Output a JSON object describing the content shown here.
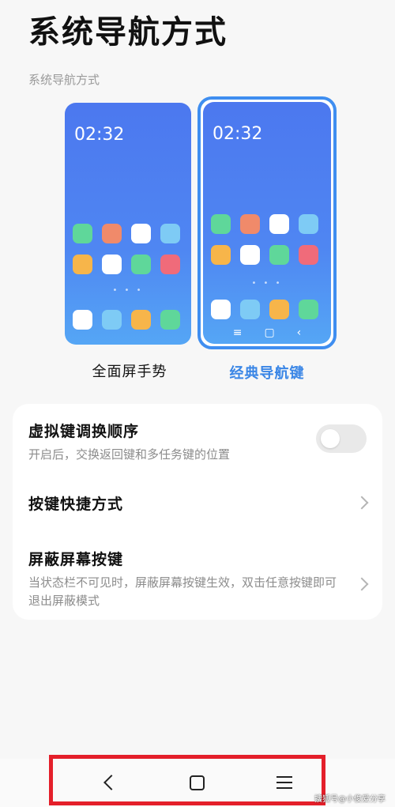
{
  "page": {
    "title": "系统导航方式",
    "section_label": "系统导航方式"
  },
  "options": {
    "gesture": {
      "time": "02:32",
      "label": "全面屏手势",
      "selected": false,
      "apps": [
        "#5fd79a",
        "#f08a6a",
        "#ffffff",
        "#7ecbf5",
        "#f7b54a",
        "#ffffff",
        "#5fd79a",
        "#f06b7a"
      ],
      "dock": [
        "#ffffff",
        "#7ecbf5",
        "#f7b54a",
        "#5fd79a"
      ]
    },
    "classic": {
      "time": "02:32",
      "label": "经典导航键",
      "selected": true,
      "apps": [
        "#5fd79a",
        "#f08a6a",
        "#ffffff",
        "#7ecbf5",
        "#f7b54a",
        "#ffffff",
        "#5fd79a",
        "#f06b7a"
      ],
      "dock": [
        "#ffffff",
        "#7ecbf5",
        "#f7b54a",
        "#5fd79a"
      ],
      "nav_glyphs": [
        "≡",
        "▢",
        "‹"
      ]
    }
  },
  "settings": {
    "swap_keys": {
      "title": "虚拟键调换顺序",
      "subtitle": "开启后，交换返回键和多任务键的位置",
      "enabled": false
    },
    "shortcuts": {
      "title": "按键快捷方式"
    },
    "block_keys": {
      "title": "屏蔽屏幕按键",
      "subtitle": "当状态栏不可见时，屏蔽屏幕按键生效，双击任意按键即可退出屏蔽模式"
    }
  },
  "navbar": {
    "buttons": [
      "back-icon",
      "home-icon",
      "menu-icon"
    ]
  },
  "watermark": "搜狐号@小俊爱分享",
  "colors": {
    "accent": "#3a86e6",
    "highlight": "#e41f2a",
    "wallpaper": "#4f86f2"
  }
}
